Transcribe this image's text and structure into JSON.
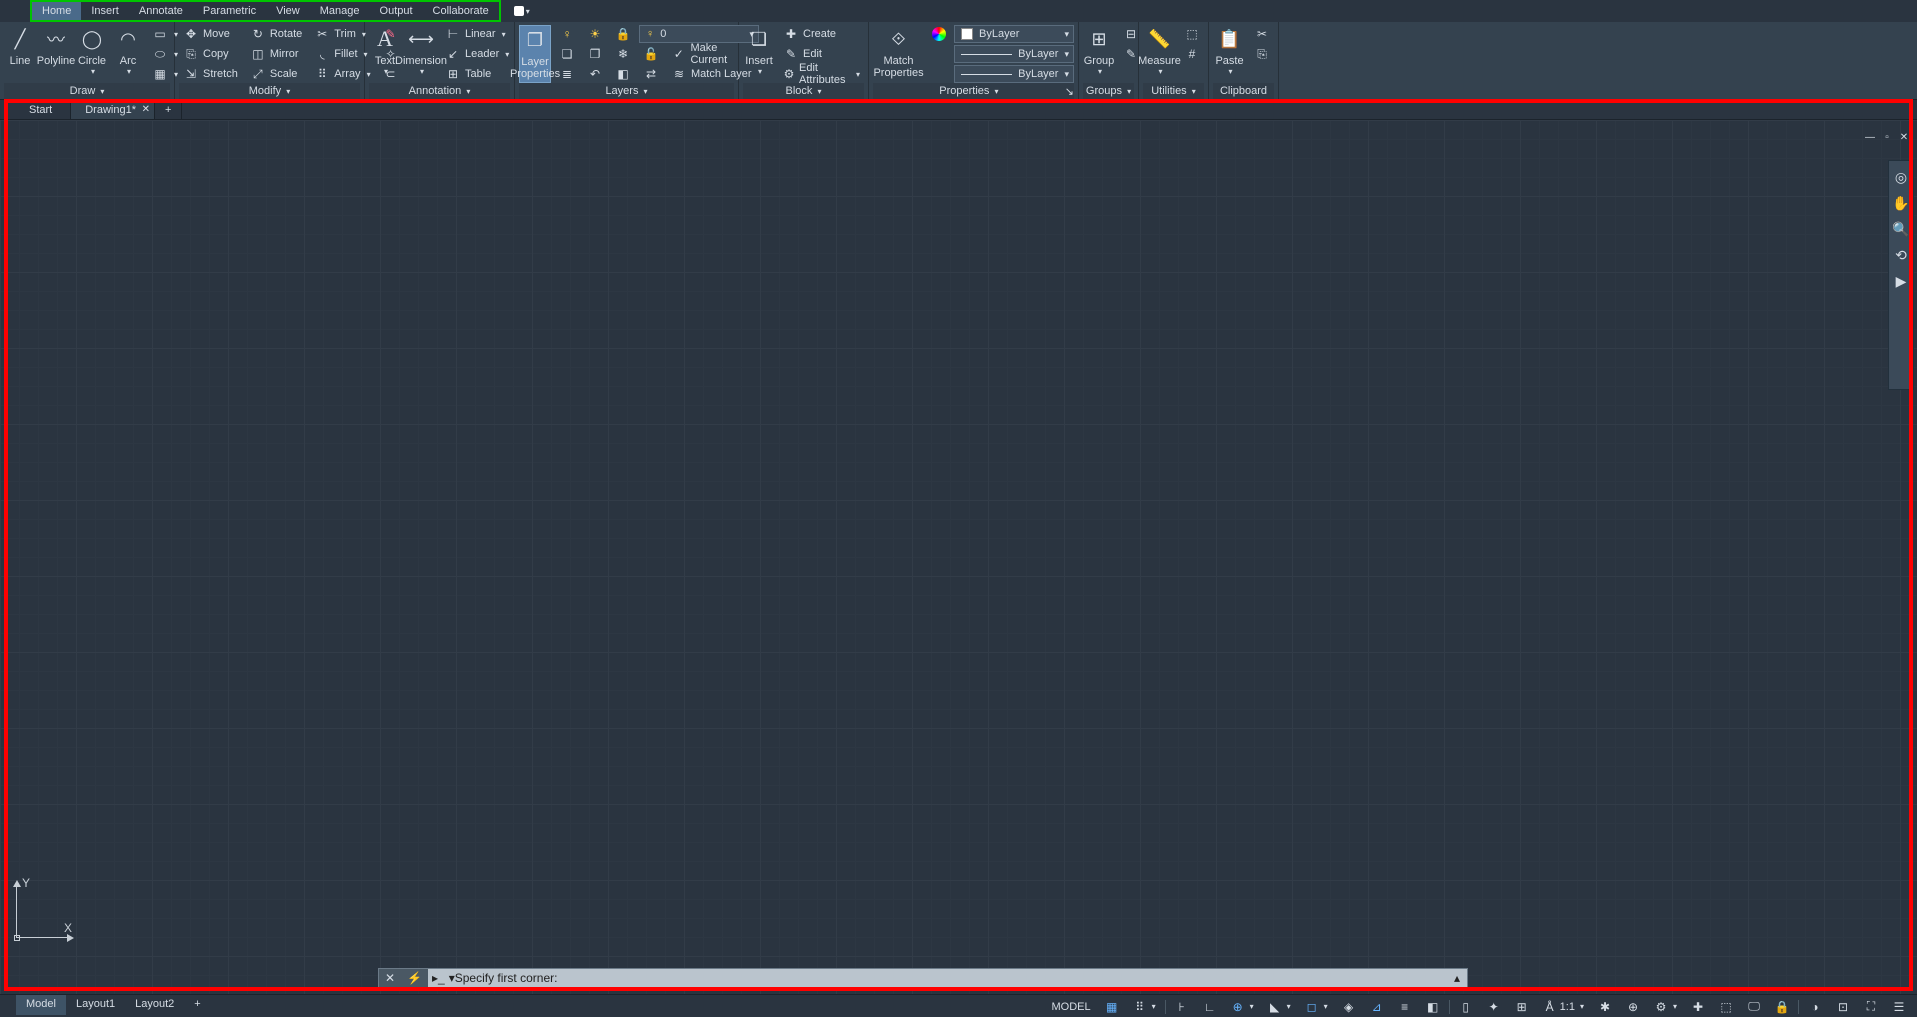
{
  "tabs": {
    "home": "Home",
    "insert": "Insert",
    "annotate": "Annotate",
    "parametric": "Parametric",
    "view": "View",
    "manage": "Manage",
    "output": "Output",
    "collaborate": "Collaborate"
  },
  "draw": {
    "line": "Line",
    "polyline": "Polyline",
    "circle": "Circle",
    "arc": "Arc",
    "title": "Draw"
  },
  "modify": {
    "move": "Move",
    "rotate": "Rotate",
    "trim": "Trim",
    "copy": "Copy",
    "mirror": "Mirror",
    "fillet": "Fillet",
    "stretch": "Stretch",
    "scale": "Scale",
    "array": "Array",
    "title": "Modify"
  },
  "annotation": {
    "text": "Text",
    "dimension": "Dimension",
    "linear": "Linear",
    "leader": "Leader",
    "table": "Table",
    "title": "Annotation"
  },
  "layers": {
    "layer_properties": "Layer\nProperties",
    "current": "0",
    "make_current": "Make Current",
    "match_layer": "Match Layer",
    "title": "Layers"
  },
  "block": {
    "insert": "Insert",
    "create": "Create",
    "edit": "Edit",
    "edit_attributes": "Edit Attributes",
    "title": "Block"
  },
  "properties": {
    "match": "Match\nProperties",
    "bylayer1": "ByLayer",
    "bylayer2": "ByLayer",
    "bylayer3": "ByLayer",
    "title": "Properties"
  },
  "groups": {
    "group": "Group",
    "title": "Groups"
  },
  "utilities": {
    "measure": "Measure",
    "title": "Utilities"
  },
  "clipboard": {
    "paste": "Paste",
    "title": "Clipboard"
  },
  "filetabs": {
    "start": "Start",
    "drawing": "Drawing1*"
  },
  "ucs": {
    "y": "Y",
    "x": "X"
  },
  "cmd": {
    "prompt": "Specify first corner:"
  },
  "layouts": {
    "model": "Model",
    "l1": "Layout1",
    "l2": "Layout2"
  },
  "status": {
    "model": "MODEL",
    "scale": "1:1"
  }
}
